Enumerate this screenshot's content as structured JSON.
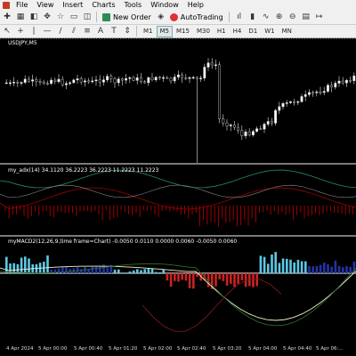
{
  "menu": {
    "items": [
      "File",
      "View",
      "Insert",
      "Charts",
      "Tools",
      "Window",
      "Help"
    ]
  },
  "toolbar": {
    "new_order": "New Order",
    "auto_trading": "AutoTrading"
  },
  "timeframes": [
    "M1",
    "M5",
    "M15",
    "M30",
    "H1",
    "H4",
    "D1",
    "W1",
    "MN"
  ],
  "active_timeframe": "M5",
  "chart": {
    "symbol_label": "USDJPY,M5",
    "ind1_label": "my_adx(14) 34.1120 36.2223 36.2223 11.2223 11.2223",
    "ind2_label": "myMACD2(12,26,9,time frame=Chart) -0.0050 0.0110 0.0000 0.0060 -0.0050 0.0060"
  },
  "time_axis": [
    "4 Apr 2024",
    "5 Apr 00:00",
    "5 Apr 00:40",
    "5 Apr 01:20",
    "5 Apr 02:00",
    "5 Apr 02:40",
    "5 Apr 03:20",
    "5 Apr 04:00",
    "5 Apr 04:40",
    "5 Apr 06:..."
  ],
  "colors": {
    "bull": "#ffffff",
    "bear": "#000000",
    "wick": "#e0e0e0",
    "adx_pos": "#2e8b57",
    "adx_neg": "#a00000",
    "hist_up": "#5bc8e6",
    "hist_dn": "#cc2222",
    "hist_blue": "#2233aa",
    "macd_line": "#f0f0c8",
    "signal_line": "#2e6b2e",
    "signal_red": "#8b1a1a"
  }
}
